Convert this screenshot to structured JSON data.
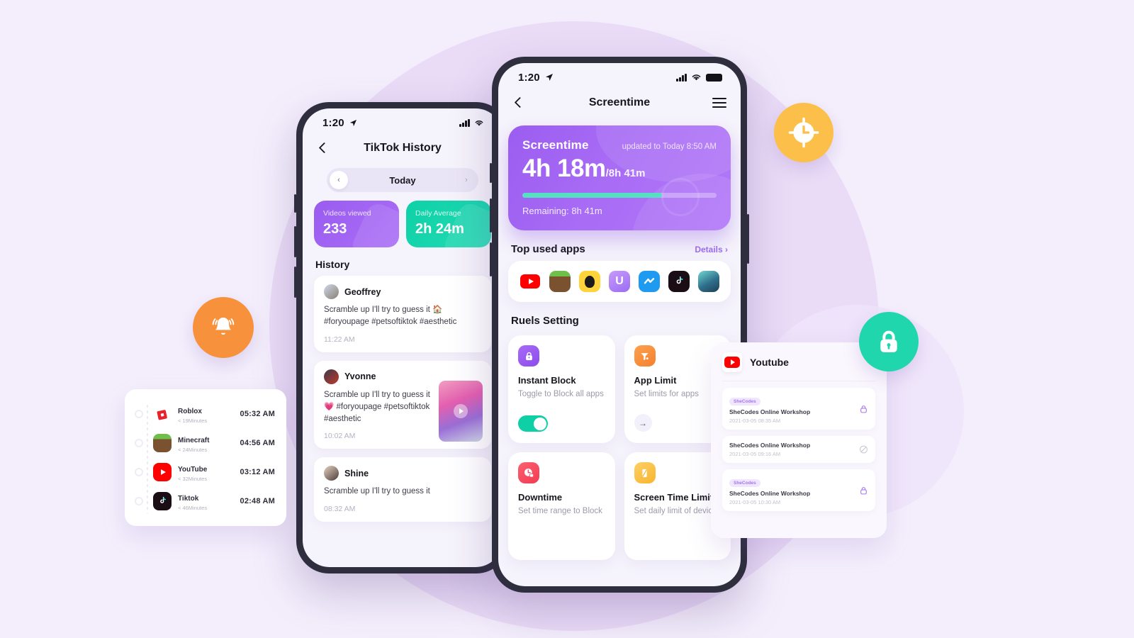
{
  "background": {
    "base_color": "#f4eefc",
    "circle_color": "#e7d8f6"
  },
  "main_phone": {
    "status_bar": {
      "time": "1:20",
      "location_icon": "location-arrow-icon",
      "signal_icon": "cellular-bars-icon",
      "wifi_icon": "wifi-icon",
      "battery_icon": "battery-full-icon"
    },
    "nav": {
      "back_icon": "chevron-left-icon",
      "title": "Screentime",
      "menu_icon": "hamburger-menu-icon"
    },
    "screentime_card": {
      "label": "Screentime",
      "updated": "updated to Today 8:50 AM",
      "used": "4h 18m",
      "total": "/8h 41m",
      "progress_percent": 72,
      "remaining": "Remaining: 8h 41m",
      "bg_color": "#a86cf5",
      "bar_color": "#55e0c2"
    },
    "top_used_apps": {
      "title": "Top used apps",
      "details_label": "Details ›",
      "apps": [
        {
          "name": "youtube-app-icon"
        },
        {
          "name": "minecraft-app-icon"
        },
        {
          "name": "qq-app-icon"
        },
        {
          "name": "u-app-icon"
        },
        {
          "name": "messenger-app-icon"
        },
        {
          "name": "tiktok-app-icon"
        },
        {
          "name": "game-app-icon"
        }
      ]
    },
    "rules": {
      "title": "Ruels Setting",
      "cards": [
        {
          "icon": "lock-icon",
          "icon_color": "#9b5df0",
          "name": "Instant Block",
          "desc": "Toggle to Block all apps",
          "control": "toggle",
          "toggle_on": true
        },
        {
          "icon": "app-limit-icon",
          "icon_color": "#f7913b",
          "name": "App Limit",
          "desc": "Set limits for apps",
          "control": "arrow",
          "arrow_glyph": "→"
        },
        {
          "icon": "downtime-clock-icon",
          "icon_color": "#f6475f",
          "name": "Downtime",
          "desc": "Set time range to Block",
          "control": "none"
        },
        {
          "icon": "phone-limit-icon",
          "icon_color": "#fcbf49",
          "name": "Screen Time Limit",
          "desc": "Set daily limit of device",
          "control": "none"
        }
      ]
    }
  },
  "mid_phone": {
    "status_bar": {
      "time": "1:20",
      "location_icon": "location-arrow-icon",
      "signal_icon": "cellular-bars-icon",
      "wifi_icon": "wifi-icon"
    },
    "nav": {
      "back_icon": "chevron-left-icon",
      "title": "TikTok History"
    },
    "day_switch": {
      "prev_glyph": "‹",
      "label": "Today",
      "next_glyph": "›"
    },
    "stats": [
      {
        "label": "Videos viewed",
        "value": "233",
        "color": "#9a5cf0"
      },
      {
        "label": "Daily Average",
        "value": "2h 24m",
        "color": "#0ed0a6"
      }
    ],
    "history_title": "History",
    "history": [
      {
        "name": "Geoffrey",
        "text": "Scramble up I'll try to guess it 🏠#foryoupage #petsoftiktok #aesthetic",
        "time": "11:22 AM",
        "has_thumb": false
      },
      {
        "name": "Yvonne",
        "text": "Scramble up I'll try to guess it 💗 #foryoupage #petsoftiktok #aesthetic",
        "time": "10:02 AM",
        "has_thumb": true
      },
      {
        "name": "Shine",
        "text": "Scramble up I'll try to guess it",
        "time": "08:32 AM",
        "has_thumb": false
      }
    ]
  },
  "usage_card": {
    "rows": [
      {
        "icon": "roblox-app-icon",
        "name": "Roblox",
        "duration": "< 19Minutes",
        "time": "05:32 AM"
      },
      {
        "icon": "minecraft-app-icon",
        "name": "Minecraft",
        "duration": "< 24Minutes",
        "time": "04:56 AM"
      },
      {
        "icon": "youtube-app-icon",
        "name": "YouTube",
        "duration": "< 32Minutes",
        "time": "03:12 AM"
      },
      {
        "icon": "tiktok-app-icon",
        "name": "Tiktok",
        "duration": "< 46Minutes",
        "time": "02:48 AM"
      }
    ]
  },
  "youtube_card": {
    "icon": "youtube-app-icon",
    "title": "Youtube",
    "items": [
      {
        "tag": "SheCodes",
        "name": "SheCodes Online Workshop",
        "date": "2021-03-05 08:35 AM",
        "state_icon": "lock-icon"
      },
      {
        "tag": "",
        "name": "SheCodes Online Workshop",
        "date": "2021-03-05 09:16 AM",
        "state_icon": "block-icon"
      },
      {
        "tag": "SheCodes",
        "name": "SheCodes Online Workshop",
        "date": "2021-03-05 10:30 AM",
        "state_icon": "lock-icon"
      }
    ]
  },
  "badges": [
    {
      "name": "notification-bell-badge",
      "icon": "bell-icon",
      "color": "#f7913b"
    },
    {
      "name": "clock-badge",
      "icon": "clock-icon",
      "color": "#fcbf49"
    },
    {
      "name": "lock-badge",
      "icon": "lock-icon",
      "color": "#1fd6ad"
    }
  ]
}
